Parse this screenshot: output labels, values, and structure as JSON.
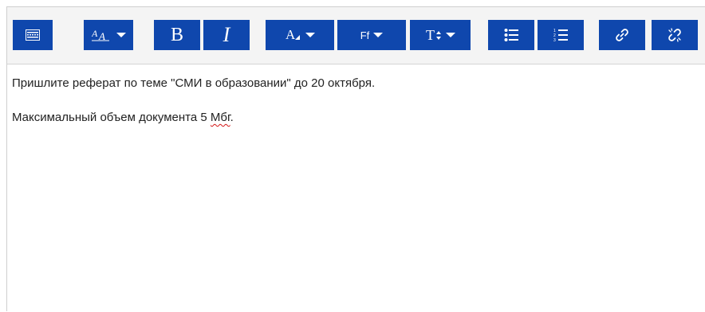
{
  "editor": {
    "toolbar": {
      "buttons": [
        {
          "id": "toggle-toolbar",
          "icon": "keyboard-rows-icon"
        },
        {
          "id": "font-style",
          "icon": "font-style-icon",
          "dropdown": true
        },
        {
          "id": "bold",
          "label": "B",
          "icon": "bold-icon"
        },
        {
          "id": "italic",
          "label": "I",
          "icon": "italic-icon"
        },
        {
          "id": "font-color",
          "icon": "font-color-icon",
          "dropdown": true
        },
        {
          "id": "font-family",
          "label": "Ff",
          "icon": "font-family-icon",
          "dropdown": true
        },
        {
          "id": "font-size",
          "icon": "font-size-icon",
          "dropdown": true
        },
        {
          "id": "bullet-list",
          "icon": "bullet-list-icon"
        },
        {
          "id": "numbered-list",
          "icon": "numbered-list-icon"
        },
        {
          "id": "link",
          "icon": "link-icon"
        },
        {
          "id": "unlink",
          "icon": "unlink-icon"
        }
      ],
      "button_color": "#0f47ad"
    },
    "content": {
      "line1": "Пришлите реферат по теме \"СМИ в образовании\" до 20 октября.",
      "line2_before": "Максимальный объем документа 5 ",
      "line2_misspelled": "Мбг",
      "line2_after": "."
    }
  }
}
